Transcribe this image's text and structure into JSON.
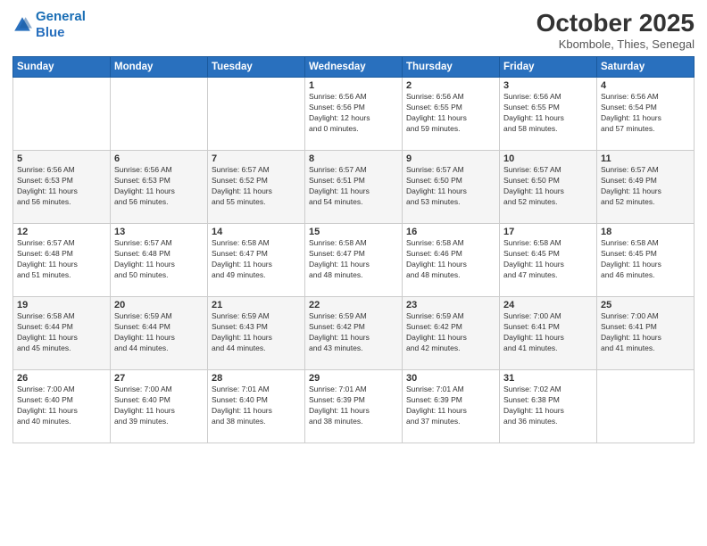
{
  "header": {
    "logo_line1": "General",
    "logo_line2": "Blue",
    "month": "October 2025",
    "location": "Kbombole, Thies, Senegal"
  },
  "weekdays": [
    "Sunday",
    "Monday",
    "Tuesday",
    "Wednesday",
    "Thursday",
    "Friday",
    "Saturday"
  ],
  "weeks": [
    [
      {
        "day": "",
        "info": ""
      },
      {
        "day": "",
        "info": ""
      },
      {
        "day": "",
        "info": ""
      },
      {
        "day": "1",
        "info": "Sunrise: 6:56 AM\nSunset: 6:56 PM\nDaylight: 12 hours\nand 0 minutes."
      },
      {
        "day": "2",
        "info": "Sunrise: 6:56 AM\nSunset: 6:55 PM\nDaylight: 11 hours\nand 59 minutes."
      },
      {
        "day": "3",
        "info": "Sunrise: 6:56 AM\nSunset: 6:55 PM\nDaylight: 11 hours\nand 58 minutes."
      },
      {
        "day": "4",
        "info": "Sunrise: 6:56 AM\nSunset: 6:54 PM\nDaylight: 11 hours\nand 57 minutes."
      }
    ],
    [
      {
        "day": "5",
        "info": "Sunrise: 6:56 AM\nSunset: 6:53 PM\nDaylight: 11 hours\nand 56 minutes."
      },
      {
        "day": "6",
        "info": "Sunrise: 6:56 AM\nSunset: 6:53 PM\nDaylight: 11 hours\nand 56 minutes."
      },
      {
        "day": "7",
        "info": "Sunrise: 6:57 AM\nSunset: 6:52 PM\nDaylight: 11 hours\nand 55 minutes."
      },
      {
        "day": "8",
        "info": "Sunrise: 6:57 AM\nSunset: 6:51 PM\nDaylight: 11 hours\nand 54 minutes."
      },
      {
        "day": "9",
        "info": "Sunrise: 6:57 AM\nSunset: 6:50 PM\nDaylight: 11 hours\nand 53 minutes."
      },
      {
        "day": "10",
        "info": "Sunrise: 6:57 AM\nSunset: 6:50 PM\nDaylight: 11 hours\nand 52 minutes."
      },
      {
        "day": "11",
        "info": "Sunrise: 6:57 AM\nSunset: 6:49 PM\nDaylight: 11 hours\nand 52 minutes."
      }
    ],
    [
      {
        "day": "12",
        "info": "Sunrise: 6:57 AM\nSunset: 6:48 PM\nDaylight: 11 hours\nand 51 minutes."
      },
      {
        "day": "13",
        "info": "Sunrise: 6:57 AM\nSunset: 6:48 PM\nDaylight: 11 hours\nand 50 minutes."
      },
      {
        "day": "14",
        "info": "Sunrise: 6:58 AM\nSunset: 6:47 PM\nDaylight: 11 hours\nand 49 minutes."
      },
      {
        "day": "15",
        "info": "Sunrise: 6:58 AM\nSunset: 6:47 PM\nDaylight: 11 hours\nand 48 minutes."
      },
      {
        "day": "16",
        "info": "Sunrise: 6:58 AM\nSunset: 6:46 PM\nDaylight: 11 hours\nand 48 minutes."
      },
      {
        "day": "17",
        "info": "Sunrise: 6:58 AM\nSunset: 6:45 PM\nDaylight: 11 hours\nand 47 minutes."
      },
      {
        "day": "18",
        "info": "Sunrise: 6:58 AM\nSunset: 6:45 PM\nDaylight: 11 hours\nand 46 minutes."
      }
    ],
    [
      {
        "day": "19",
        "info": "Sunrise: 6:58 AM\nSunset: 6:44 PM\nDaylight: 11 hours\nand 45 minutes."
      },
      {
        "day": "20",
        "info": "Sunrise: 6:59 AM\nSunset: 6:44 PM\nDaylight: 11 hours\nand 44 minutes."
      },
      {
        "day": "21",
        "info": "Sunrise: 6:59 AM\nSunset: 6:43 PM\nDaylight: 11 hours\nand 44 minutes."
      },
      {
        "day": "22",
        "info": "Sunrise: 6:59 AM\nSunset: 6:42 PM\nDaylight: 11 hours\nand 43 minutes."
      },
      {
        "day": "23",
        "info": "Sunrise: 6:59 AM\nSunset: 6:42 PM\nDaylight: 11 hours\nand 42 minutes."
      },
      {
        "day": "24",
        "info": "Sunrise: 7:00 AM\nSunset: 6:41 PM\nDaylight: 11 hours\nand 41 minutes."
      },
      {
        "day": "25",
        "info": "Sunrise: 7:00 AM\nSunset: 6:41 PM\nDaylight: 11 hours\nand 41 minutes."
      }
    ],
    [
      {
        "day": "26",
        "info": "Sunrise: 7:00 AM\nSunset: 6:40 PM\nDaylight: 11 hours\nand 40 minutes."
      },
      {
        "day": "27",
        "info": "Sunrise: 7:00 AM\nSunset: 6:40 PM\nDaylight: 11 hours\nand 39 minutes."
      },
      {
        "day": "28",
        "info": "Sunrise: 7:01 AM\nSunset: 6:40 PM\nDaylight: 11 hours\nand 38 minutes."
      },
      {
        "day": "29",
        "info": "Sunrise: 7:01 AM\nSunset: 6:39 PM\nDaylight: 11 hours\nand 38 minutes."
      },
      {
        "day": "30",
        "info": "Sunrise: 7:01 AM\nSunset: 6:39 PM\nDaylight: 11 hours\nand 37 minutes."
      },
      {
        "day": "31",
        "info": "Sunrise: 7:02 AM\nSunset: 6:38 PM\nDaylight: 11 hours\nand 36 minutes."
      },
      {
        "day": "",
        "info": ""
      }
    ]
  ]
}
